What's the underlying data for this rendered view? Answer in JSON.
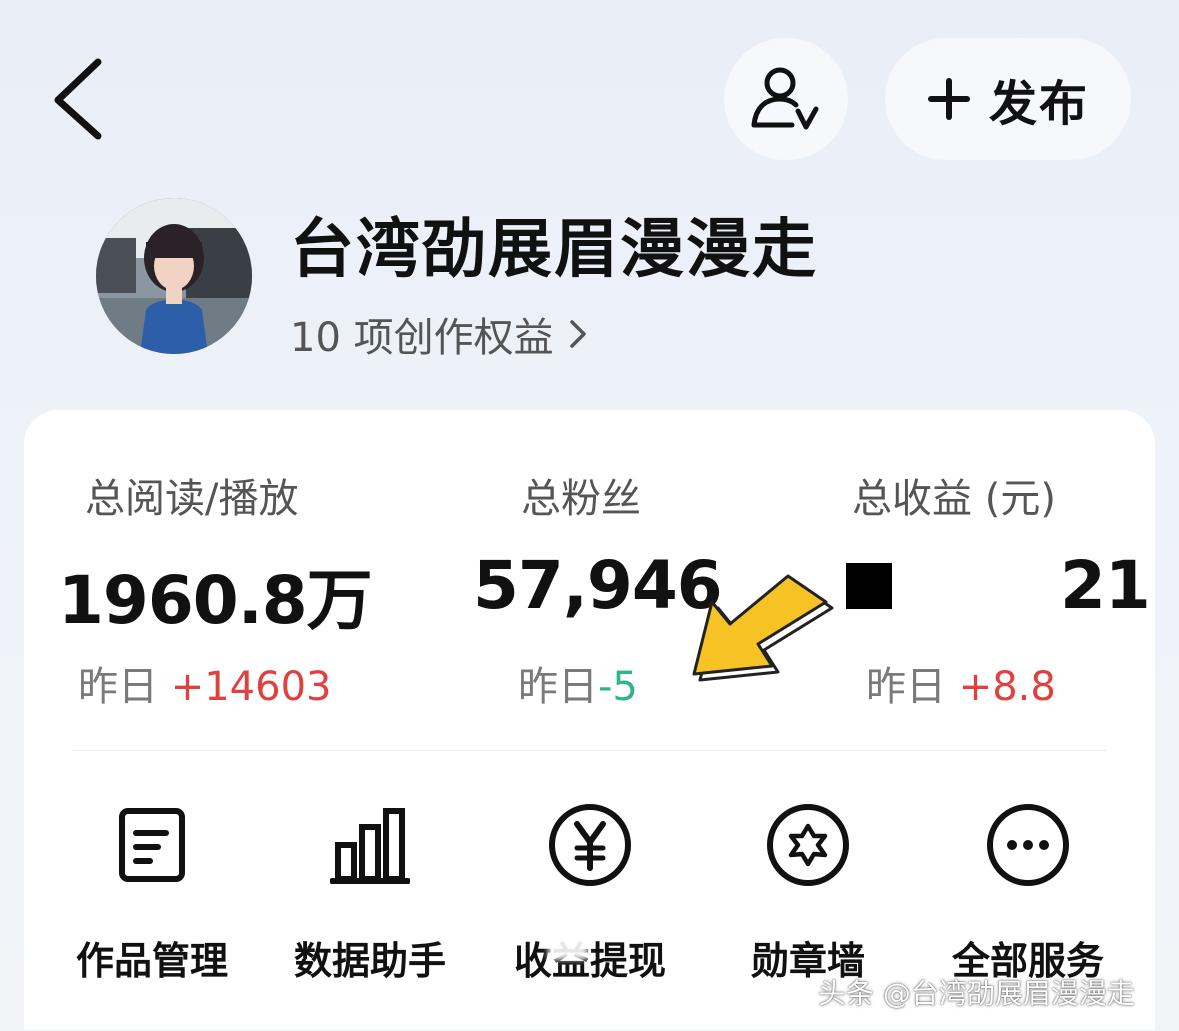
{
  "header": {
    "back_icon": "chevron-left-icon",
    "user_verify_icon": "user-verified-icon",
    "publish_label": "发布",
    "publish_icon": "plus-icon"
  },
  "profile": {
    "name": "台湾劭展眉漫漫走",
    "benefits": "10 项创作权益"
  },
  "stats": [
    {
      "label": "总阅读/播放",
      "value": "1960.8万",
      "change_prefix": "昨日",
      "change": "+14603",
      "change_color": "#e0413f"
    },
    {
      "label": "总粉丝",
      "value": "57,946",
      "change_prefix": "昨日",
      "change": "-5",
      "change_color": "#2fb58a"
    },
    {
      "label": "总收益 (元)",
      "value": "21",
      "change_prefix": "昨日",
      "change": "+8.8",
      "change_color": "#e0413f"
    }
  ],
  "services": [
    {
      "label": "作品管理",
      "icon": "document-icon"
    },
    {
      "label": "数据助手",
      "icon": "bar-chart-icon"
    },
    {
      "label": "收益提现",
      "icon": "yen-icon"
    },
    {
      "label": "勋章墙",
      "icon": "medal-star-icon"
    },
    {
      "label": "全部服务",
      "icon": "more-dots-icon"
    }
  ],
  "watermark": "头条 @台湾劭展眉漫漫走",
  "colors": {
    "accent_positive": "#e0413f",
    "accent_negative": "#2fb58a",
    "arrow": "#f7c324"
  }
}
